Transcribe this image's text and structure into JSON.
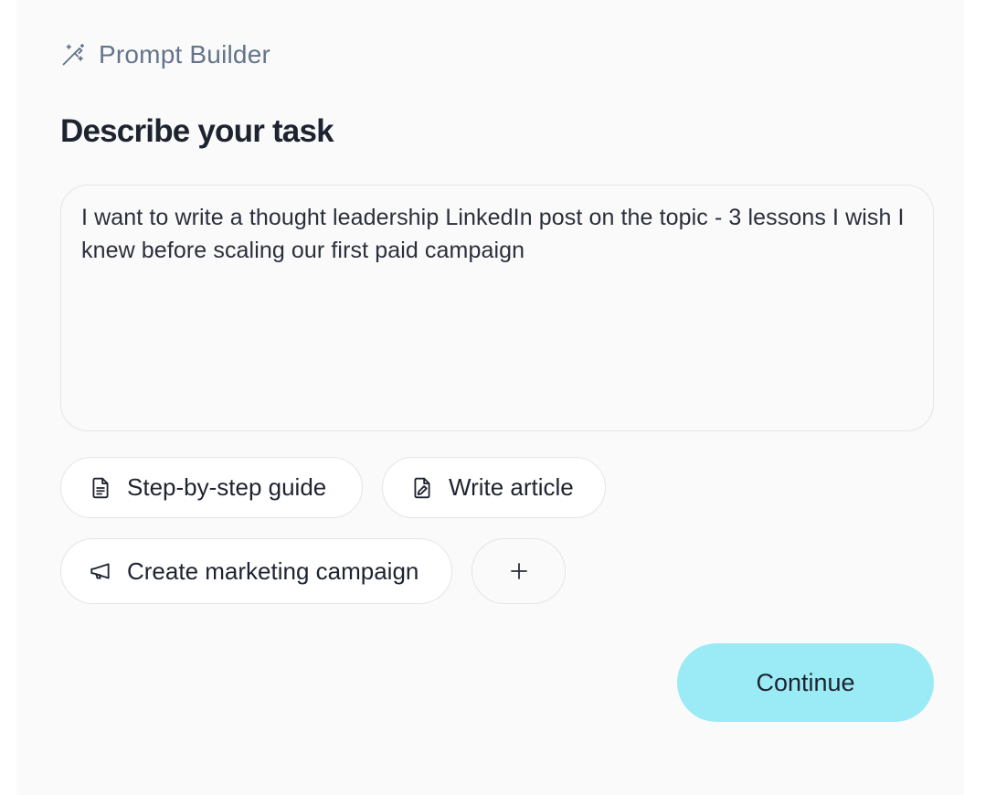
{
  "header": {
    "icon": "magic-wand-icon",
    "title": "Prompt Builder"
  },
  "main": {
    "heading": "Describe your task",
    "task_input": {
      "value": "I want to write a thought leadership LinkedIn post on the topic - 3 lessons I wish I knew before scaling our first paid campaign"
    }
  },
  "suggestions": [
    {
      "label": "Step-by-step guide",
      "icon": "document-icon"
    },
    {
      "label": "Write article",
      "icon": "document-pen-icon"
    },
    {
      "label": "Create marketing campaign",
      "icon": "megaphone-icon"
    }
  ],
  "add_suggestion": {
    "icon": "plus-icon",
    "label": "+"
  },
  "actions": {
    "continue_label": "Continue"
  },
  "colors": {
    "panel_background": "#fafafa",
    "continue_button": "#9aebf5",
    "header_text": "#64748b",
    "heading_text": "#1e2330",
    "border": "#e3e5ea"
  }
}
